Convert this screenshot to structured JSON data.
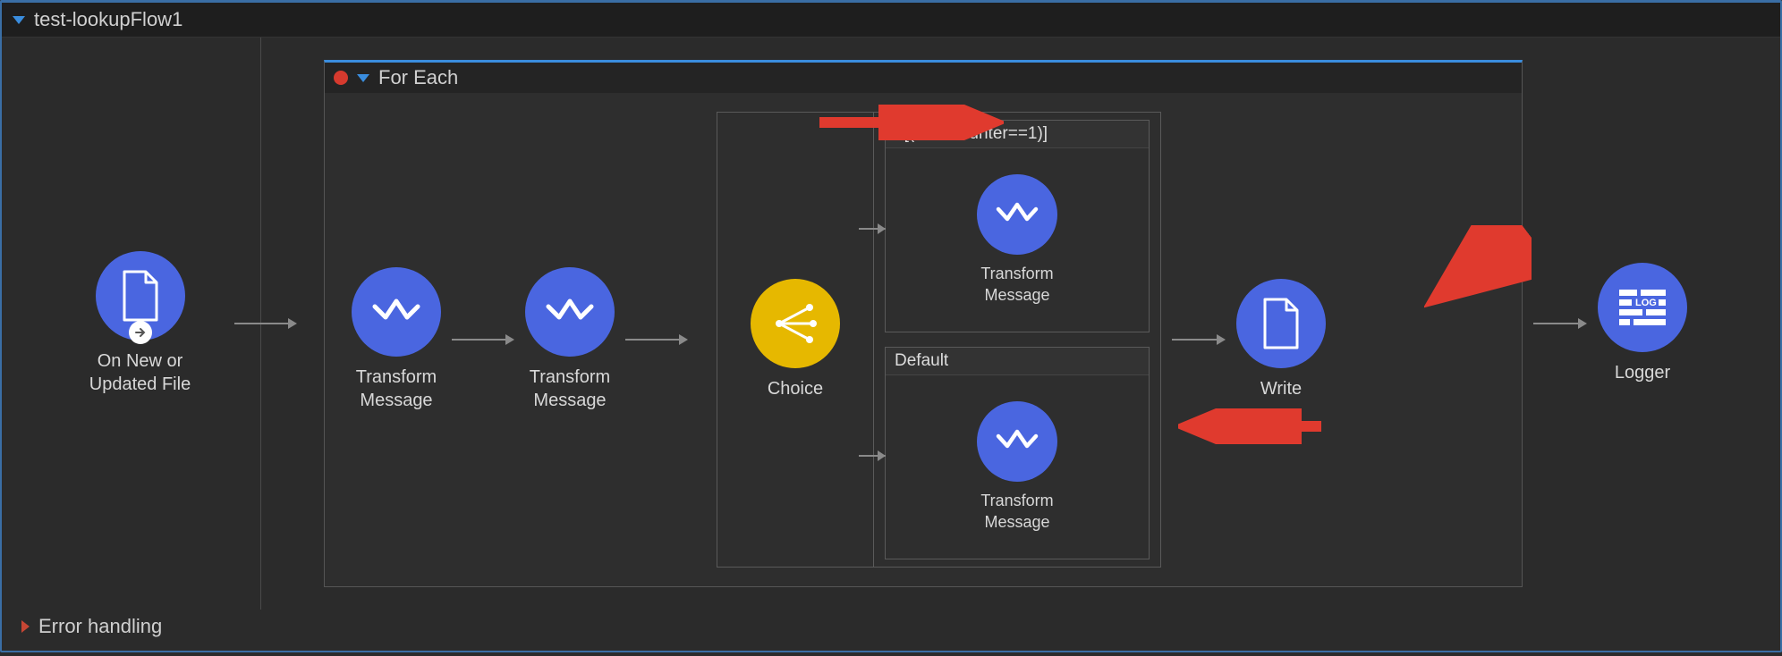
{
  "flow": {
    "name": "test-lookupFlow1",
    "error_section_label": "Error handling"
  },
  "source": {
    "label": "On New or\nUpdated File"
  },
  "foreach": {
    "title": "For Each"
  },
  "nodes": {
    "transform1": "Transform\nMessage",
    "transform2": "Transform\nMessage",
    "choice": "Choice",
    "route1_condition": "#[(vars.counter==1)]",
    "route1_node": "Transform\nMessage",
    "route2_title": "Default",
    "route2_node": "Transform\nMessage",
    "write": "Write",
    "logger": "Logger"
  },
  "colors": {
    "node": "#4a66e0",
    "choice": "#e6b800",
    "annotation": "#e03a2e"
  }
}
